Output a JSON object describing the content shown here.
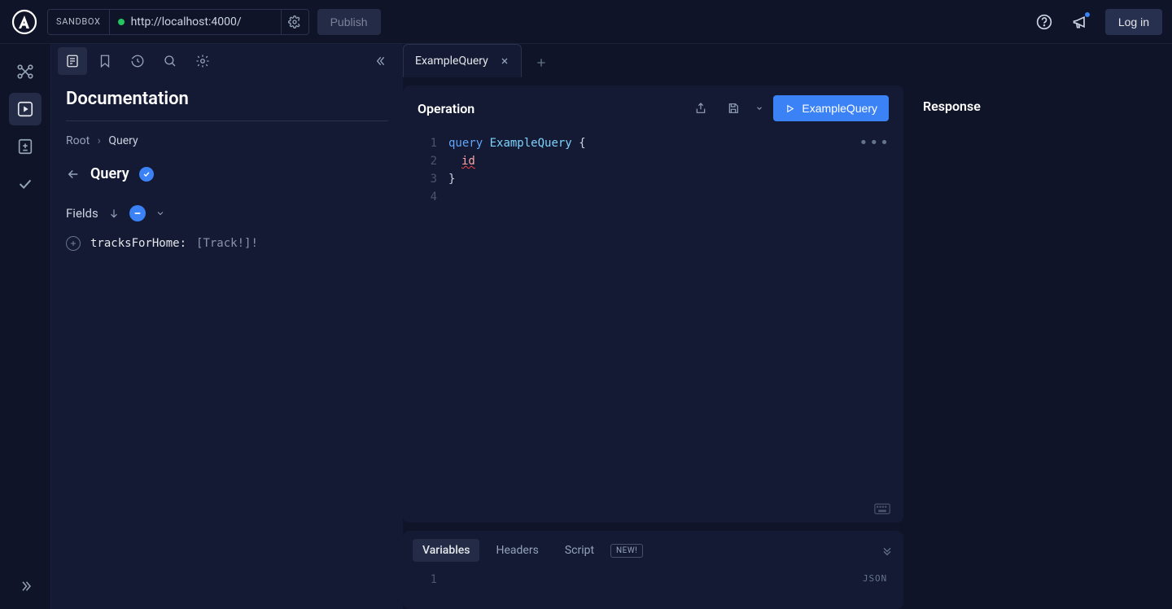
{
  "topbar": {
    "sandbox_label": "SANDBOX",
    "url": "http://localhost:4000/",
    "publish_label": "Publish",
    "login_label": "Log in"
  },
  "docs": {
    "title": "Documentation",
    "crumb_root": "Root",
    "crumb_current": "Query",
    "type_name": "Query",
    "fields_label": "Fields",
    "field": {
      "name": "tracksForHome:",
      "type": "[Track!]!"
    }
  },
  "tabs": {
    "active": "ExampleQuery"
  },
  "operation": {
    "title": "Operation",
    "run_label": "ExampleQuery",
    "lines": {
      "1": "1",
      "2": "2",
      "3": "3",
      "4": "4"
    },
    "code": {
      "kw": "query",
      "name": "ExampleQuery",
      "open": "{",
      "field": "id",
      "close": "}"
    }
  },
  "variables": {
    "tab_variables": "Variables",
    "tab_headers": "Headers",
    "tab_script": "Script",
    "new_badge": "NEW!",
    "line1": "1",
    "format": "JSON"
  },
  "response": {
    "title": "Response"
  }
}
